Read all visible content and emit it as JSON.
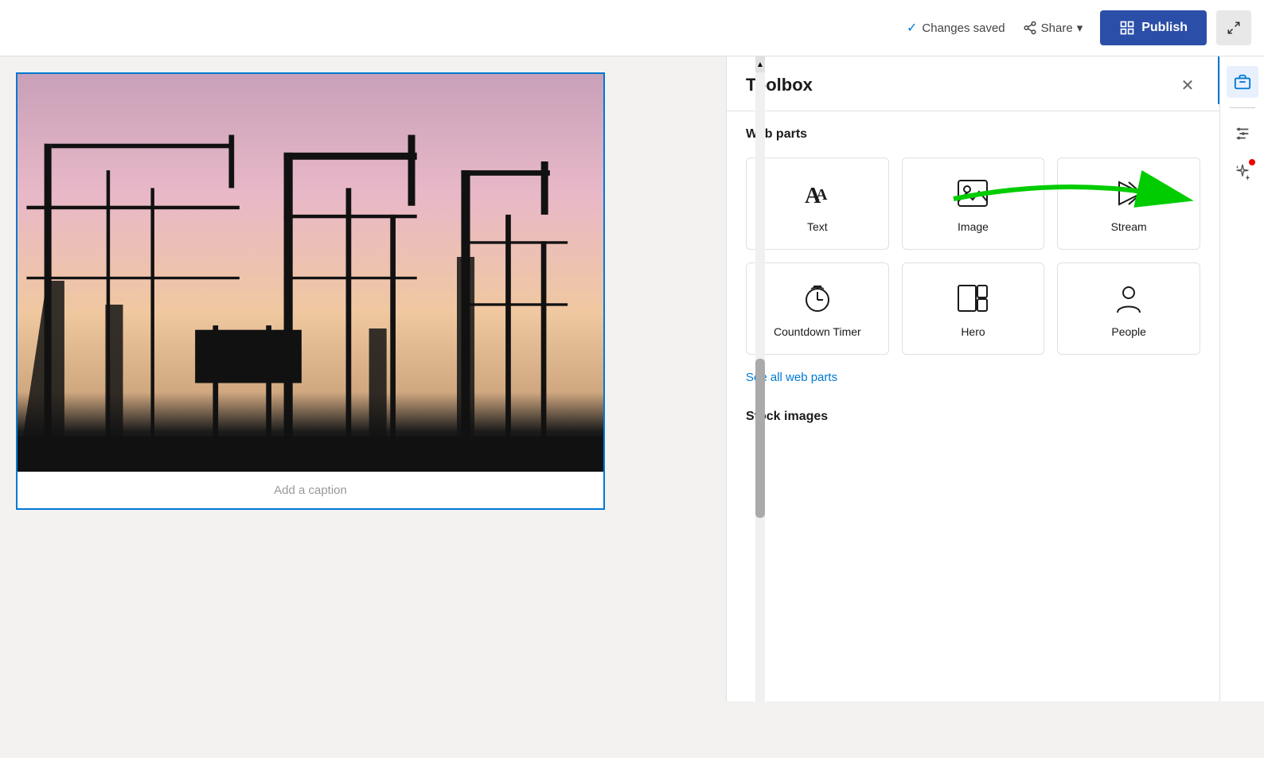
{
  "topbar": {
    "changes_saved_label": "Changes saved",
    "share_label": "Share",
    "publish_label": "Publish",
    "collapse_icon": "⤢"
  },
  "toolbox": {
    "title": "Toolbox",
    "close_icon": "✕",
    "sections": {
      "web_parts": {
        "title": "Web parts",
        "items": [
          {
            "id": "text",
            "label": "Text"
          },
          {
            "id": "image",
            "label": "Image"
          },
          {
            "id": "stream",
            "label": "Stream"
          },
          {
            "id": "countdown",
            "label": "Countdown Timer"
          },
          {
            "id": "hero",
            "label": "Hero"
          },
          {
            "id": "people",
            "label": "People"
          }
        ],
        "see_all_label": "See all web parts"
      },
      "stock_images": {
        "title": "Stock images"
      }
    }
  },
  "canvas": {
    "caption_placeholder": "Add a caption"
  },
  "sidebar": {
    "icons": [
      {
        "id": "briefcase",
        "label": "Briefcase",
        "active": true
      },
      {
        "id": "settings",
        "label": "Settings",
        "active": false
      },
      {
        "id": "sparkle",
        "label": "Sparkle",
        "active": false,
        "notification": true
      }
    ]
  }
}
